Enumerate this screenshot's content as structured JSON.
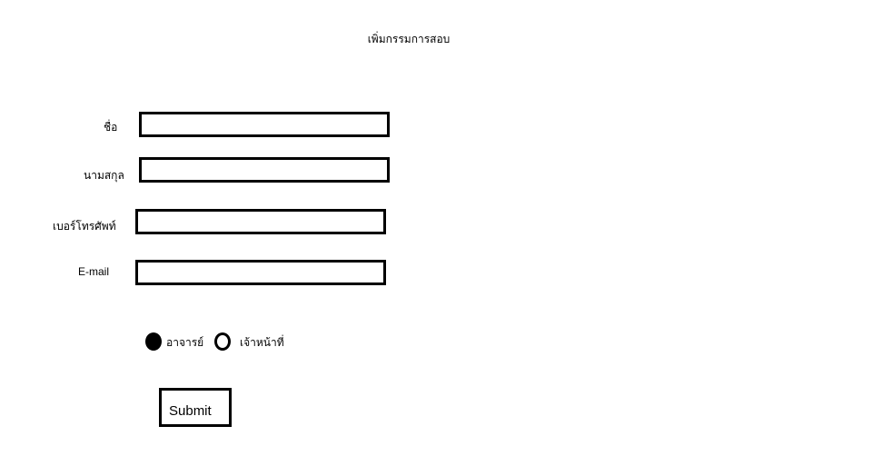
{
  "page": {
    "title": "เพิ่มกรรมการสอบ"
  },
  "form": {
    "fields": [
      {
        "label": "ชื่อ",
        "value": ""
      },
      {
        "label": "นามสกุล",
        "value": ""
      },
      {
        "label": "เบอร์โทรศัพท์",
        "value": ""
      },
      {
        "label": "E-mail",
        "value": ""
      }
    ],
    "role": {
      "options": [
        {
          "label": "อาจารย์",
          "selected": true
        },
        {
          "label": "เจ้าหน้าที่",
          "selected": false
        }
      ]
    },
    "submit_label": "Submit"
  }
}
